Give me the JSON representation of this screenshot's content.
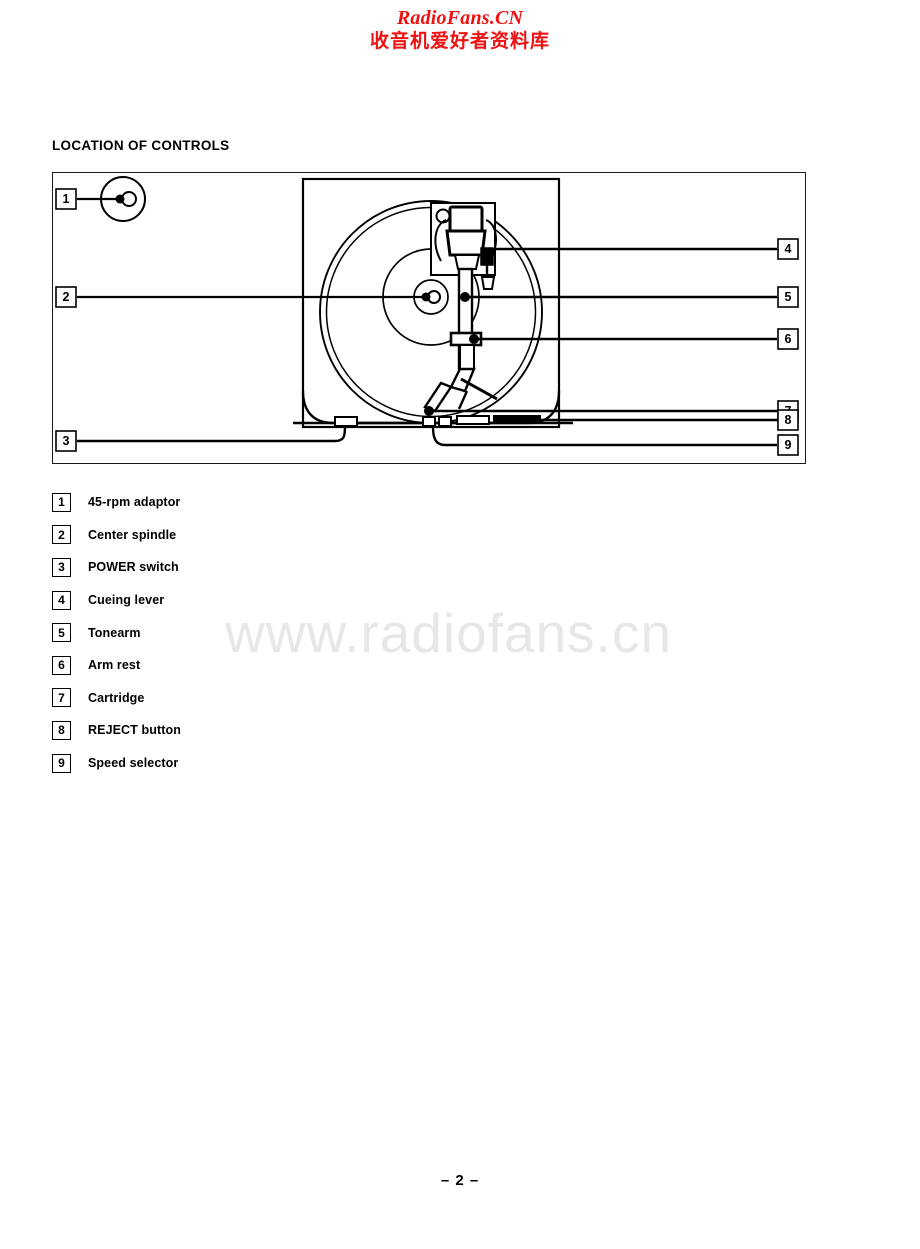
{
  "watermark": {
    "header_latin": "RadioFans.CN",
    "header_cjk": "收音机爱好者资料库",
    "header_color": "#ee1111",
    "body_text": "www.radiofans.cn",
    "body_color": "#e7e7e7"
  },
  "section": {
    "title": "LOCATION OF CONTROLS"
  },
  "figure": {
    "name": "turntable-location-of-controls-diagram",
    "callouts": [
      {
        "number": "1",
        "target": "45-rpm adaptor"
      },
      {
        "number": "2",
        "target": "Center spindle"
      },
      {
        "number": "3",
        "target": "POWER switch"
      },
      {
        "number": "4",
        "target": "Cueing lever"
      },
      {
        "number": "5",
        "target": "Tonearm"
      },
      {
        "number": "6",
        "target": "Arm rest"
      },
      {
        "number": "7",
        "target": "Cartridge"
      },
      {
        "number": "8",
        "target": "REJECT button"
      },
      {
        "number": "9",
        "target": "Speed selector"
      }
    ]
  },
  "legend": {
    "items": [
      {
        "number": "1",
        "label": "45-rpm adaptor"
      },
      {
        "number": "2",
        "label": "Center spindle"
      },
      {
        "number": "3",
        "label": "POWER switch"
      },
      {
        "number": "4",
        "label": "Cueing lever"
      },
      {
        "number": "5",
        "label": "Tonearm"
      },
      {
        "number": "6",
        "label": "Arm rest"
      },
      {
        "number": "7",
        "label": "Cartridge"
      },
      {
        "number": "8",
        "label": "REJECT button"
      },
      {
        "number": "9",
        "label": "Speed selector"
      }
    ]
  },
  "footer": {
    "page_number": "– 2 –"
  }
}
